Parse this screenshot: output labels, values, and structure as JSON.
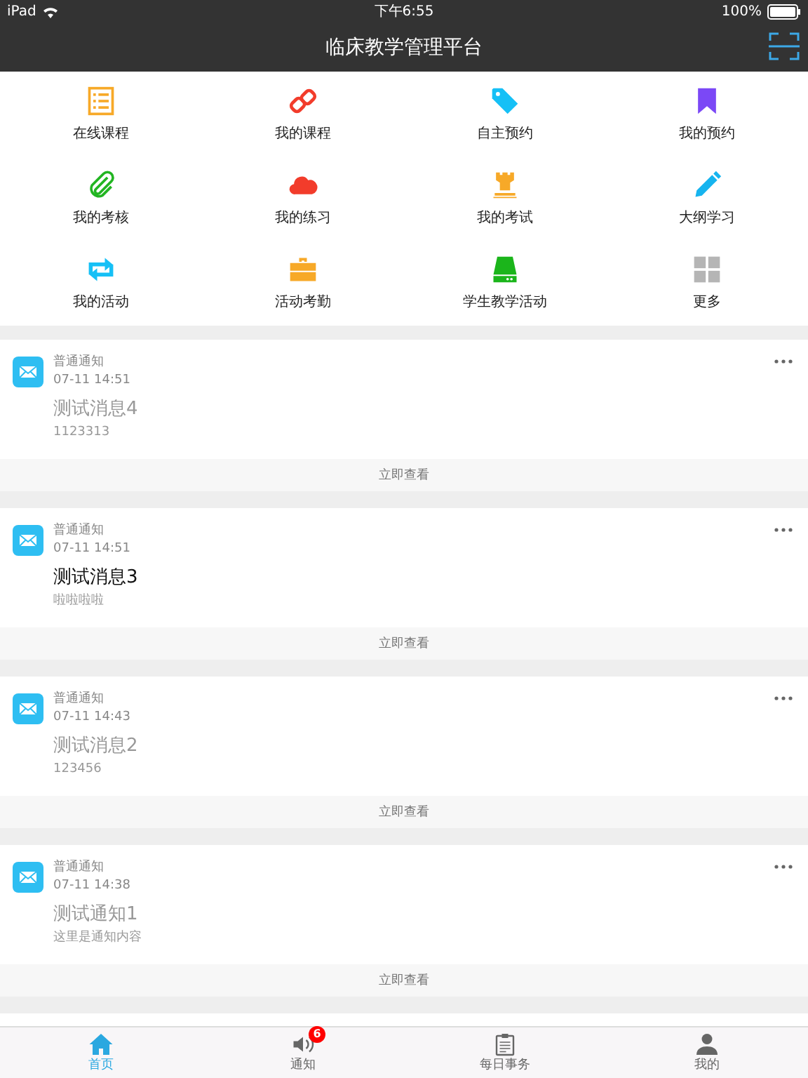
{
  "status_bar": {
    "device": "iPad",
    "time": "下午6:55",
    "battery": "100%"
  },
  "nav_bar": {
    "title": "临床教学管理平台"
  },
  "menu": [
    {
      "label": "在线课程"
    },
    {
      "label": "我的课程"
    },
    {
      "label": "自主预约"
    },
    {
      "label": "我的预约"
    },
    {
      "label": "我的考核"
    },
    {
      "label": "我的练习"
    },
    {
      "label": "我的考试"
    },
    {
      "label": "大纲学习"
    },
    {
      "label": "我的活动"
    },
    {
      "label": "活动考勤"
    },
    {
      "label": "学生教学活动"
    },
    {
      "label": "更多"
    }
  ],
  "messages": [
    {
      "category": "普通通知",
      "time": "07-11 14:51",
      "title": "测试消息4",
      "body": "1123313",
      "read": true,
      "action": "立即查看"
    },
    {
      "category": "普通通知",
      "time": "07-11 14:51",
      "title": "测试消息3",
      "body": "啦啦啦啦",
      "read": false,
      "action": "立即查看"
    },
    {
      "category": "普通通知",
      "time": "07-11 14:43",
      "title": "测试消息2",
      "body": "123456",
      "read": true,
      "action": "立即查看"
    },
    {
      "category": "普通通知",
      "time": "07-11 14:38",
      "title": "测试通知1",
      "body": "这里是通知内容",
      "read": true,
      "action": "立即查看"
    }
  ],
  "tab_bar": [
    {
      "label": "首页",
      "selected": true
    },
    {
      "label": "通知",
      "selected": false,
      "badge": "6"
    },
    {
      "label": "每日事务",
      "selected": false
    },
    {
      "label": "我的",
      "selected": false
    }
  ]
}
